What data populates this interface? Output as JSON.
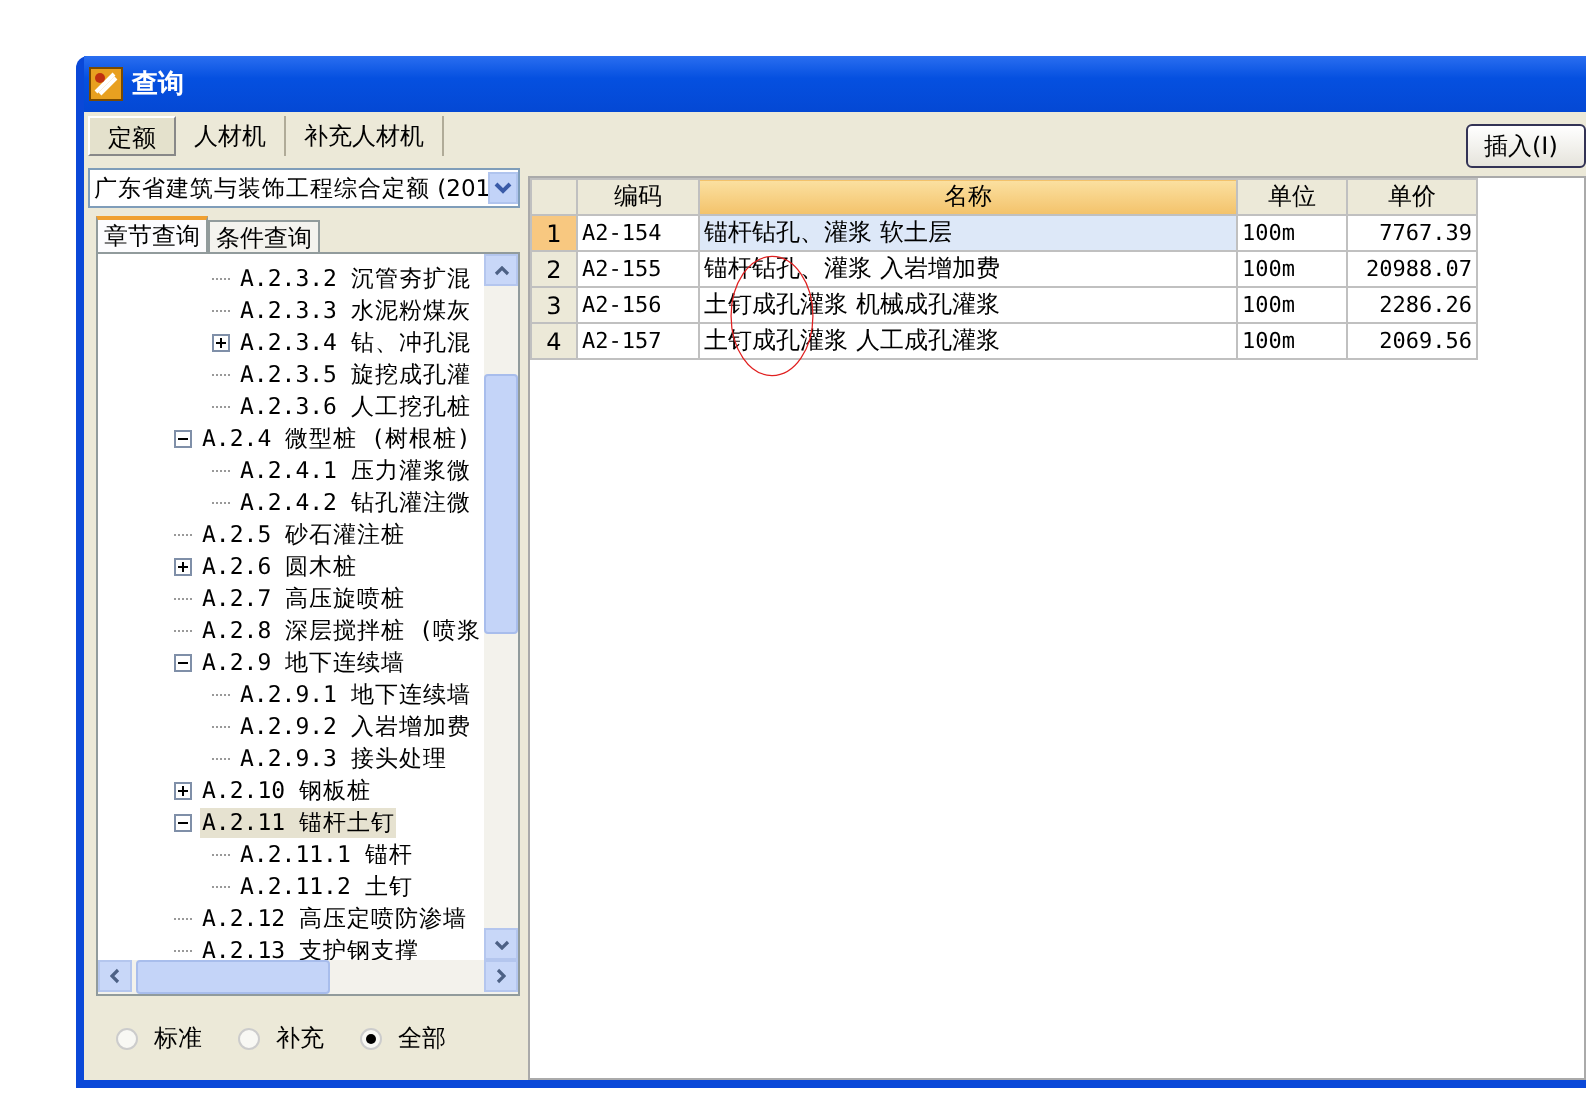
{
  "window": {
    "title": "查询"
  },
  "tabs": [
    {
      "label": "定额",
      "selected": true
    },
    {
      "label": "人材机",
      "selected": false
    },
    {
      "label": "补充人材机",
      "selected": false
    }
  ],
  "insert_button": {
    "label": "插入(I)"
  },
  "quota_dropdown": {
    "value": "广东省建筑与装饰工程综合定额 (201"
  },
  "sub_tabs": [
    {
      "label": "章节查询",
      "selected": true
    },
    {
      "label": "条件查询",
      "selected": false
    }
  ],
  "tree": [
    {
      "children": [
        {
          "label": "A.2.3.2 沉管夯扩混",
          "selected": false
        },
        {
          "label": "A.2.3.3 水泥粉煤灰",
          "selected": false
        },
        {
          "label": "A.2.3.4 钻、冲孔混",
          "selected": false,
          "expanded": false
        },
        {
          "label": "A.2.3.5 旋挖成孔灌",
          "selected": false
        },
        {
          "label": "A.2.3.6 人工挖孔桩",
          "selected": false
        }
      ]
    },
    {
      "label": "A.2.4 微型桩 (树根桩)",
      "selected": false,
      "expanded": true,
      "children": [
        {
          "label": "A.2.4.1 压力灌浆微",
          "selected": false
        },
        {
          "label": "A.2.4.2 钻孔灌注微",
          "selected": false
        }
      ]
    },
    {
      "label": "A.2.5 砂石灌注桩",
      "selected": false
    },
    {
      "label": "A.2.6 圆木桩",
      "selected": false,
      "expanded": false
    },
    {
      "label": "A.2.7 高压旋喷桩",
      "selected": false
    },
    {
      "label": "A.2.8 深层搅拌桩 (喷浆",
      "selected": false
    },
    {
      "label": "A.2.9 地下连续墙",
      "selected": false,
      "expanded": true,
      "children": [
        {
          "label": "A.2.9.1 地下连续墙",
          "selected": false
        },
        {
          "label": "A.2.9.2 入岩增加费",
          "selected": false
        },
        {
          "label": "A.2.9.3 接头处理",
          "selected": false
        }
      ]
    },
    {
      "label": "A.2.10 钢板桩",
      "selected": false,
      "expanded": false
    },
    {
      "label": "A.2.11 锚杆土钉",
      "selected": true,
      "expanded": true,
      "children": [
        {
          "label": "A.2.11.1 锚杆",
          "selected": false
        },
        {
          "label": "A.2.11.2 土钉",
          "selected": false
        }
      ]
    },
    {
      "label": "A.2.12 高压定喷防渗墙",
      "selected": false
    },
    {
      "label": "A.2.13 支护钢支撑",
      "selected": false
    }
  ],
  "filter_radios": [
    {
      "label": "标准",
      "selected": false
    },
    {
      "label": "补充",
      "selected": false
    },
    {
      "label": "全部",
      "selected": true
    }
  ],
  "table": {
    "columns": [
      {
        "label": "编码",
        "sorted": false
      },
      {
        "label": "名称",
        "sorted": true
      },
      {
        "label": "单位",
        "sorted": false
      },
      {
        "label": "单价",
        "sorted": false
      }
    ],
    "rows": [
      {
        "number": "1",
        "cells": [
          "A2-154",
          "锚杆钻孔、灌浆 软土层",
          "100m",
          "7767.39"
        ],
        "selected": true
      },
      {
        "number": "2",
        "cells": [
          "A2-155",
          "锚杆钻孔、灌浆 入岩增加费",
          "100m",
          "20988.07"
        ],
        "selected": false
      },
      {
        "number": "3",
        "cells": [
          "A2-156",
          "土钉成孔灌浆 机械成孔灌浆",
          "100m",
          "2286.26"
        ],
        "selected": false
      },
      {
        "number": "4",
        "cells": [
          "A2-157",
          "土钉成孔灌浆 人工成孔灌浆",
          "100m",
          "2069.56"
        ],
        "selected": false
      }
    ]
  }
}
